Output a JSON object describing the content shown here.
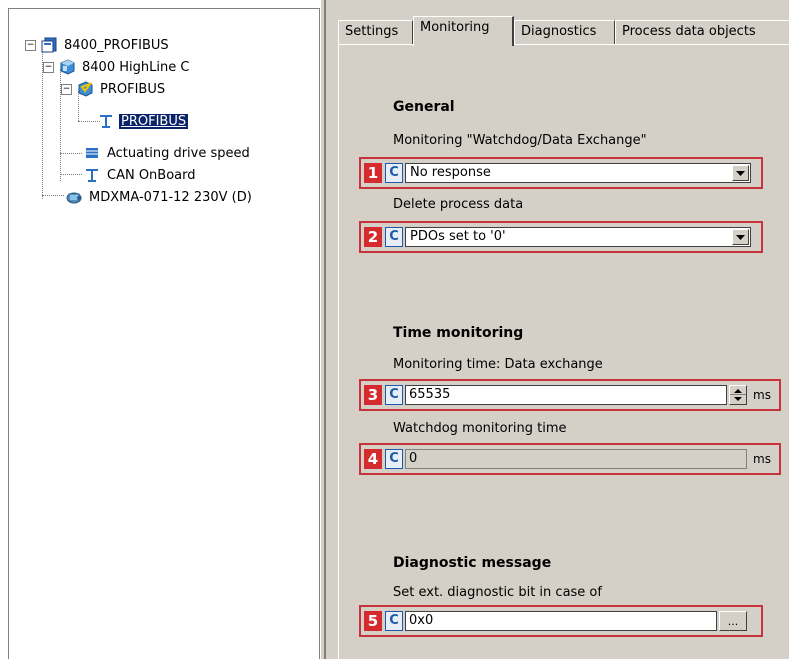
{
  "tree": {
    "root": {
      "label": "8400_PROFIBUS",
      "expander": "−",
      "icon": "project-icon"
    },
    "device": {
      "label": "8400 HighLine C",
      "expander": "−",
      "icon": "device-icon"
    },
    "module": {
      "label": "PROFIBUS",
      "expander": "−",
      "icon": "module-icon"
    },
    "bus": {
      "label": "PROFIBUS",
      "icon": "bus-icon",
      "selected": true
    },
    "speed": {
      "label": "Actuating drive speed",
      "icon": "function-icon"
    },
    "can": {
      "label": "CAN OnBoard",
      "icon": "bus-icon"
    },
    "motor": {
      "label": "MDXMA-071-12 230V (D)",
      "icon": "motor-icon"
    }
  },
  "tabs": [
    {
      "label": "Settings",
      "active": false
    },
    {
      "label": "Monitoring",
      "active": true
    },
    {
      "label": "Diagnostics",
      "active": false
    },
    {
      "label": "Process data objects",
      "active": false
    }
  ],
  "general": {
    "heading": "General",
    "watchdog_label": "Monitoring \"Watchdog/Data Exchange\"",
    "watchdog_value": "No response",
    "delete_label": "Delete process data",
    "delete_value": "PDOs set to '0'"
  },
  "time": {
    "heading": "Time monitoring",
    "data_exchange_label": "Monitoring time: Data exchange",
    "data_exchange_value": "65535",
    "data_exchange_unit": "ms",
    "watchdog_time_label": "Watchdog monitoring time",
    "watchdog_time_value": "0",
    "watchdog_time_unit": "ms"
  },
  "diag": {
    "heading": "Diagnostic message",
    "ext_label": "Set ext. diagnostic bit in case of",
    "ext_value": "0x0",
    "ellipsis": "..."
  },
  "markers": [
    "1",
    "2",
    "3",
    "4",
    "5"
  ],
  "c_label": "C",
  "colors": {
    "marker": "#d52b2f",
    "highlight_border": "#c8323a",
    "c_button": "#1e5aa8",
    "selection": "#0a246a",
    "dialog_bg": "#d4d0c8"
  }
}
